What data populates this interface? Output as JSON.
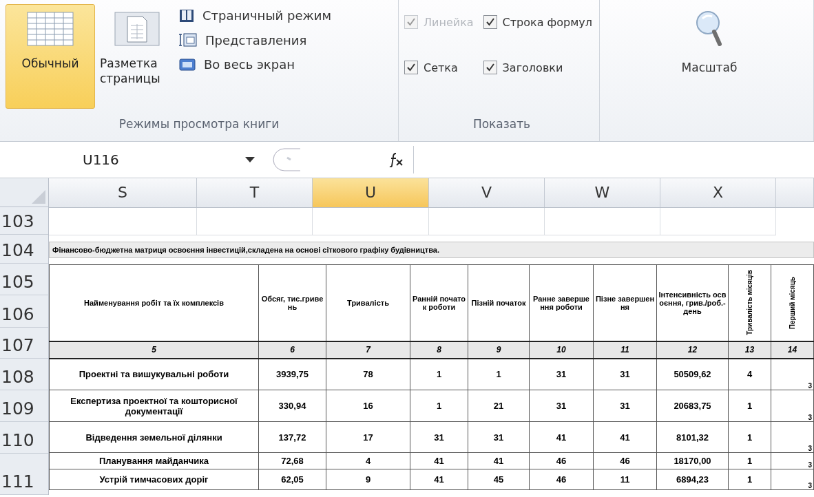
{
  "ribbon": {
    "view_group": {
      "label": "Режимы просмотра книги",
      "large_buttons": [
        {
          "label": "Обычный",
          "kind": "normal",
          "selected": true
        },
        {
          "label": "Разметка страницы",
          "kind": "page_layout",
          "selected": false
        }
      ],
      "small_buttons": [
        {
          "label": "Страничный режим",
          "kind": "page_break"
        },
        {
          "label": "Представления",
          "kind": "views"
        },
        {
          "label": "Во весь экран",
          "kind": "full_screen"
        }
      ]
    },
    "show_group": {
      "label": "Показать",
      "checkboxes": [
        {
          "label": "Линейка",
          "checked": true,
          "disabled": true
        },
        {
          "label": "Строка формул",
          "checked": true,
          "disabled": false
        },
        {
          "label": "Сетка",
          "checked": true,
          "disabled": false
        },
        {
          "label": "Заголовки",
          "checked": true,
          "disabled": false
        }
      ]
    },
    "zoom_button": {
      "label": "Масштаб"
    }
  },
  "formula_bar": {
    "name_box": "U116"
  },
  "columns": [
    {
      "label": "S",
      "selected": false
    },
    {
      "label": "T",
      "selected": false
    },
    {
      "label": "U",
      "selected": true
    },
    {
      "label": "V",
      "selected": false
    },
    {
      "label": "W",
      "selected": false
    },
    {
      "label": "X",
      "selected": false
    }
  ],
  "row_numbers": [
    "103",
    "104",
    "105",
    "106",
    "107",
    "108",
    "109",
    "110",
    "111"
  ],
  "sheet_title": "Фінансово-бюджетна матриця  освоєння  інвестицій,складена на основі сіткового графіку будівництва.",
  "table": {
    "headers": [
      {
        "text": "Найменування робіт та їх комплексів",
        "vertical": false
      },
      {
        "text": "Обсяг, тис.гривень",
        "vertical": false
      },
      {
        "text": "Тривалість",
        "vertical": false
      },
      {
        "text": "Ранній початок роботи",
        "vertical": false
      },
      {
        "text": "Пізній початок",
        "vertical": false
      },
      {
        "text": "Ранне завершення роботи",
        "vertical": false
      },
      {
        "text": "Пізне завершення",
        "vertical": false
      },
      {
        "text": "Інтенсивність освоєння, грив./роб.-день",
        "vertical": false
      },
      {
        "text": "Тривалість місяців",
        "vertical": true
      },
      {
        "text": "Перший місяць",
        "vertical": true
      }
    ],
    "numbers": [
      "5",
      "6",
      "7",
      "8",
      "9",
      "10",
      "11",
      "12",
      "13",
      "14"
    ],
    "rows": [
      [
        "Проектні та вишукувальні роботи",
        "3939,75",
        "78",
        "1",
        "1",
        "31",
        "31",
        "50509,62",
        "4",
        "3"
      ],
      [
        "Експертиза проектної  та кошторисної документації",
        "330,94",
        "16",
        "1",
        "21",
        "31",
        "31",
        "20683,75",
        "1",
        "3"
      ],
      [
        "Відведення земельної ділянки",
        "137,72",
        "17",
        "31",
        "31",
        "41",
        "41",
        "8101,32",
        "1",
        "3"
      ],
      [
        "Планування майданчика",
        "72,68",
        "4",
        "41",
        "41",
        "46",
        "46",
        "18170,00",
        "1",
        "3"
      ],
      [
        "Устрій тимчасових доріг",
        "62,05",
        "9",
        "41",
        "45",
        "46",
        "11",
        "6894,23",
        "1",
        "3"
      ]
    ]
  }
}
